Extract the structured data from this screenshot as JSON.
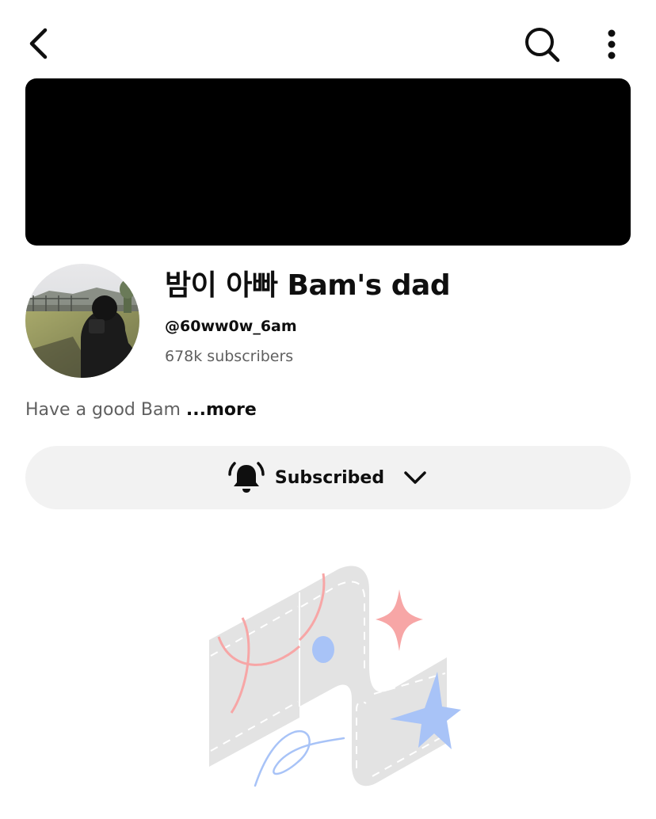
{
  "header": {
    "back_icon": "chevron-left-icon",
    "search_icon": "search-icon",
    "more_icon": "more-vertical-icon"
  },
  "channel": {
    "name": "밤이 아빠 Bam's dad",
    "handle": "@60ww0w_6am",
    "subscribers": "678k subscribers",
    "description": "Have a good Bam ",
    "more_label": "...more"
  },
  "subscribe": {
    "label": "Subscribed",
    "bell_icon": "bell-ringing-icon",
    "chevron_icon": "chevron-down-icon",
    "bg_color": "#f2f2f2"
  },
  "colors": {
    "text_primary": "#0f0f0f",
    "text_secondary": "#606060",
    "banner": "#000000",
    "illustration_pink": "#f7a6a6",
    "illustration_blue": "#a8c3f7"
  }
}
